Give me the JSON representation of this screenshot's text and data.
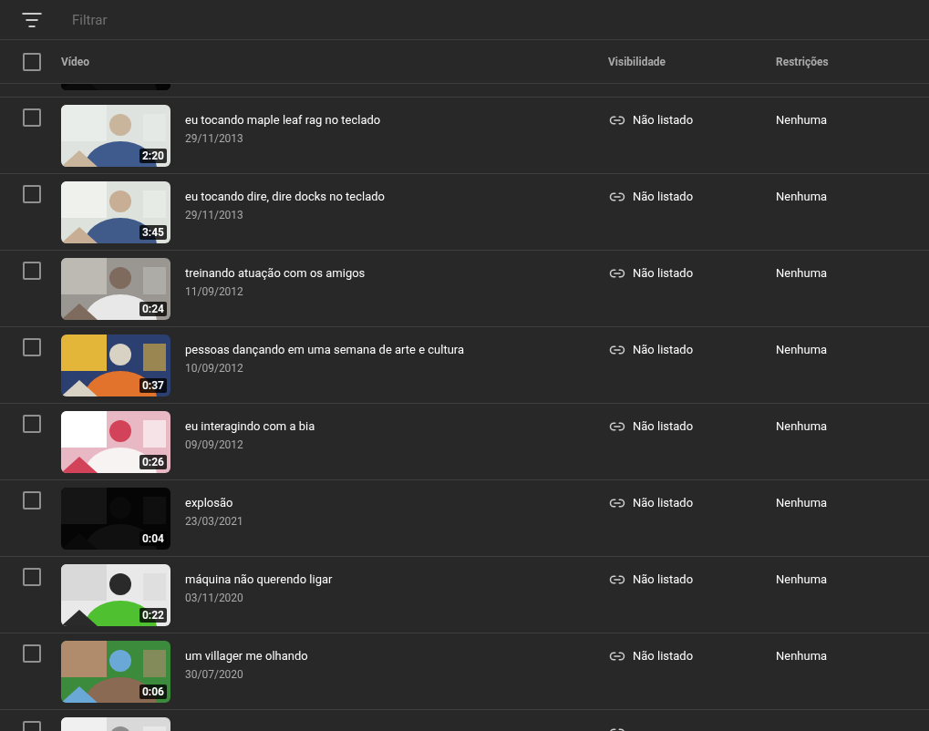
{
  "filter": {
    "placeholder": "Filtrar"
  },
  "header": {
    "checked": false,
    "columns": [
      "Vídeo",
      "Visibilidade",
      "Restrições"
    ]
  },
  "rows": [
    {
      "checked": false,
      "duration": "2:20",
      "title": "eu tocando maple leaf rag no teclado",
      "date": "29/11/2013",
      "visibility": "Não listado",
      "restrictions": "Nenhuma"
    },
    {
      "checked": false,
      "duration": "3:45",
      "title": "eu tocando dire, dire docks no teclado",
      "date": "29/11/2013",
      "visibility": "Não listado",
      "restrictions": "Nenhuma"
    },
    {
      "checked": false,
      "duration": "0:24",
      "title": "treinando atuação com os amigos",
      "date": "11/09/2012",
      "visibility": "Não listado",
      "restrictions": "Nenhuma"
    },
    {
      "checked": false,
      "duration": "0:37",
      "title": "pessoas dançando em uma semana de arte e cultura",
      "date": "10/09/2012",
      "visibility": "Não listado",
      "restrictions": "Nenhuma"
    },
    {
      "checked": false,
      "duration": "0:26",
      "title": "eu interagindo com a bia",
      "date": "09/09/2012",
      "visibility": "Não listado",
      "restrictions": "Nenhuma"
    },
    {
      "checked": false,
      "duration": "0:04",
      "title": "explosão",
      "date": "23/03/2021",
      "visibility": "Não listado",
      "restrictions": "Nenhuma"
    },
    {
      "checked": false,
      "duration": "0:22",
      "title": "máquina não querendo ligar",
      "date": "03/11/2020",
      "visibility": "Não listado",
      "restrictions": "Nenhuma"
    },
    {
      "checked": false,
      "duration": "0:06",
      "title": "um villager me olhando",
      "date": "30/07/2020",
      "visibility": "Não listado",
      "restrictions": "Nenhuma"
    },
    {
      "checked": false
    }
  ]
}
